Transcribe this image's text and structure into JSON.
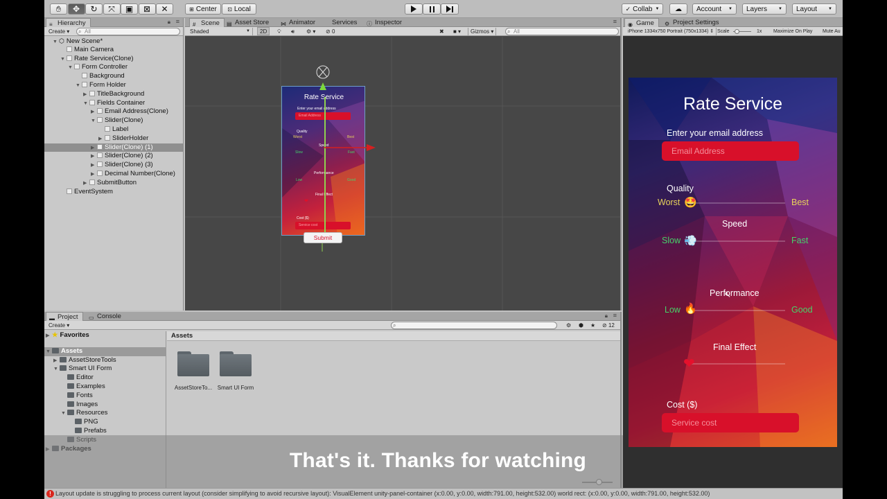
{
  "toolbar": {
    "tools": [
      "hand-tool-icon",
      "move-tool-icon",
      "rotate-tool-icon",
      "scale-tool-icon",
      "rect-tool-icon",
      "transform-tool-icon",
      "custom-tool-icon"
    ],
    "pivot": "Center",
    "space": "Local",
    "collab": "Collab",
    "account": "Account",
    "layers": "Layers",
    "layout": "Layout"
  },
  "hierarchy": {
    "tab": "Hierarchy",
    "create": "Create",
    "search_placeholder": "All",
    "items": [
      {
        "label": "New Scene*",
        "depth": 0,
        "expanded": true,
        "scene": true
      },
      {
        "label": "Main Camera",
        "depth": 1
      },
      {
        "label": "Rate Service(Clone)",
        "depth": 1,
        "expanded": true
      },
      {
        "label": "Form Controller",
        "depth": 2,
        "expanded": true
      },
      {
        "label": "Background",
        "depth": 3
      },
      {
        "label": "Form Holder",
        "depth": 3,
        "expanded": true
      },
      {
        "label": "TitleBackground",
        "depth": 4,
        "collapsed": true
      },
      {
        "label": "Fields Container",
        "depth": 4,
        "expanded": true
      },
      {
        "label": "Email Address(Clone)",
        "depth": 5,
        "collapsed": true
      },
      {
        "label": "Slider(Clone)",
        "depth": 5,
        "expanded": true
      },
      {
        "label": "Label",
        "depth": 6
      },
      {
        "label": "SliderHolder",
        "depth": 6,
        "collapsed": true
      },
      {
        "label": "Slider(Clone) (1)",
        "depth": 5,
        "collapsed": true,
        "selected": true
      },
      {
        "label": "Slider(Clone) (2)",
        "depth": 5,
        "collapsed": true
      },
      {
        "label": "Slider(Clone) (3)",
        "depth": 5,
        "collapsed": true
      },
      {
        "label": "Decimal Number(Clone)",
        "depth": 5,
        "collapsed": true
      },
      {
        "label": "SubmitButton",
        "depth": 4,
        "collapsed": true
      },
      {
        "label": "EventSystem",
        "depth": 1
      }
    ]
  },
  "scene": {
    "tabs": [
      "Scene",
      "Asset Store",
      "Animator",
      "Services",
      "Inspector"
    ],
    "shading": "Shaded",
    "mode_2d": "2D",
    "gizmo_count": "0",
    "gizmos": "Gizmos",
    "search_placeholder": "All",
    "form": {
      "title": "Rate Service",
      "email_label": "Enter your email address",
      "email_placeholder": "Email Address",
      "quality": "Quality",
      "worst": "Worst",
      "best": "Best",
      "speed": "Speed",
      "slow": "Slow",
      "fast": "Fast",
      "performance": "Performance",
      "low": "Low",
      "good": "Good",
      "final": "Final Effect",
      "cost": "Cost ($)",
      "cost_placeholder": "Service cost",
      "submit": "Submit"
    }
  },
  "game": {
    "tabs": [
      "Game",
      "Project Settings"
    ],
    "resolution": "iPhone 1334x750 Portrait (750x1334)",
    "scale_label": "Scale",
    "scale_value": "1x",
    "maximize": "Maximize On Play",
    "mute": "Mute Au",
    "form": {
      "title": "Rate Service",
      "email_label": "Enter your email address",
      "email_placeholder": "Email Address",
      "quality": "Quality",
      "worst": "Worst",
      "best": "Best",
      "speed": "Speed",
      "slow": "Slow",
      "fast": "Fast",
      "performance": "Performance",
      "low": "Low",
      "good": "Good",
      "final": "Final Effect",
      "cost": "Cost ($)",
      "cost_placeholder": "Service cost"
    }
  },
  "project": {
    "tabs": [
      "Project",
      "Console"
    ],
    "create": "Create",
    "badge": "12",
    "tree": [
      {
        "label": "Favorites",
        "depth": 0,
        "star": true
      },
      {
        "label": "Assets",
        "depth": 0,
        "selected": true,
        "expanded": true
      },
      {
        "label": "AssetStoreTools",
        "depth": 1,
        "collapsed": true
      },
      {
        "label": "Smart UI Form",
        "depth": 1,
        "expanded": true
      },
      {
        "label": "Editor",
        "depth": 2
      },
      {
        "label": "Examples",
        "depth": 2
      },
      {
        "label": "Fonts",
        "depth": 2
      },
      {
        "label": "Images",
        "depth": 2
      },
      {
        "label": "Resources",
        "depth": 2,
        "expanded": true
      },
      {
        "label": "PNG",
        "depth": 3
      },
      {
        "label": "Prefabs",
        "depth": 3
      },
      {
        "label": "Scripts",
        "depth": 2
      },
      {
        "label": "Packages",
        "depth": 0,
        "collapsed": true
      }
    ],
    "breadcrumb": "Assets",
    "assets": [
      "AssetStoreTo...",
      "Smart UI Form"
    ]
  },
  "subtitle": "That's it. Thanks for watching",
  "status_message": "Layout update is struggling to process current layout (consider simplifying to avoid recursive layout): VisualElement unity-panel-container (x:0.00, y:0.00, width:791.00, height:532.00) world rect: (x:0.00, y:0.00, width:791.00, height:532.00)",
  "colors": {
    "accent_red": "#d8102a",
    "label_yellow": "#e8d35a",
    "label_green": "#46d36a",
    "editor_bg": "#c2c2c2",
    "scene_bg": "#474747",
    "error_red": "#d9271e"
  }
}
